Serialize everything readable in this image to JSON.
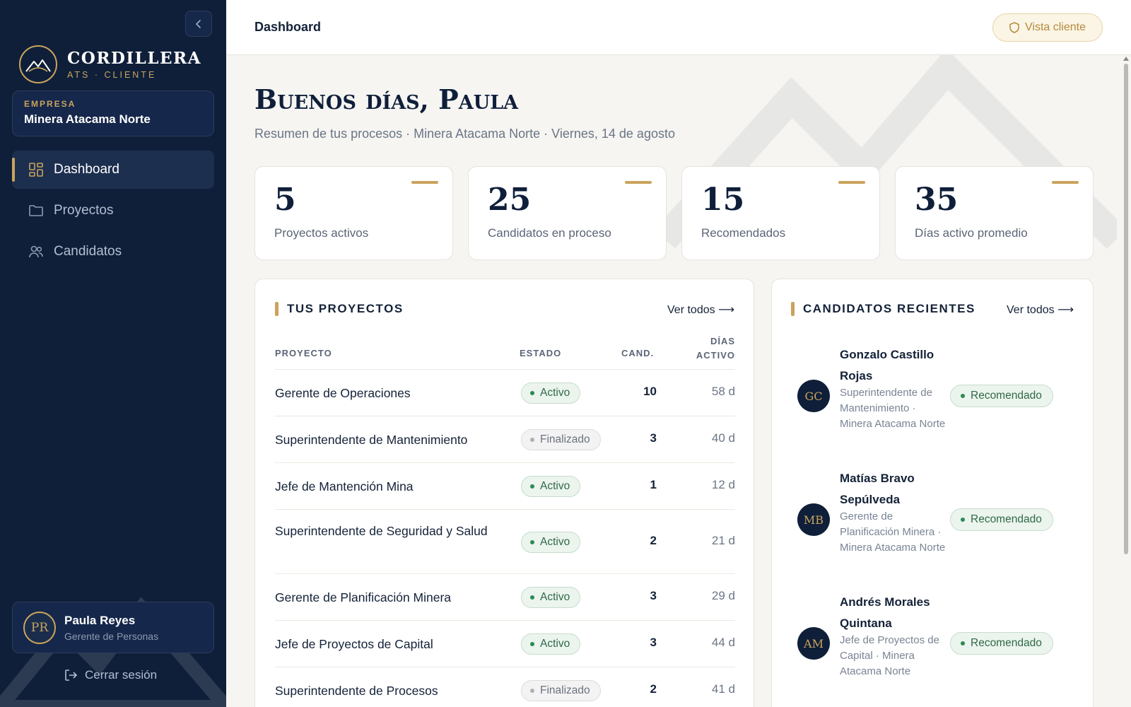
{
  "sidebar": {
    "brand_name": "CORDILLERA",
    "brand_sub": "ATS · CLIENTE",
    "company_label": "EMPRESA",
    "company_name": "Minera Atacama Norte",
    "nav": [
      {
        "label": "Dashboard",
        "icon": "grid-icon",
        "active": true
      },
      {
        "label": "Proyectos",
        "icon": "folder-icon",
        "active": false
      },
      {
        "label": "Candidatos",
        "icon": "users-icon",
        "active": false
      }
    ],
    "user": {
      "initials": "PR",
      "name": "Paula Reyes",
      "role": "Gerente de Personas"
    },
    "logout_label": "Cerrar sesión"
  },
  "header": {
    "title": "Dashboard",
    "client_view_label": "Vista cliente"
  },
  "main": {
    "greeting": "Buenos días, Paula",
    "subtitle": "Resumen de tus procesos · Minera Atacama Norte · Viernes, 14 de agosto",
    "stats": [
      {
        "value": "5",
        "label": "Proyectos activos"
      },
      {
        "value": "25",
        "label": "Candidatos en proceso"
      },
      {
        "value": "15",
        "label": "Recomendados"
      },
      {
        "value": "35",
        "label": "Días activo promedio"
      }
    ],
    "projects": {
      "title": "TUS PROYECTOS",
      "see_all": "Ver todos ⟶",
      "columns": {
        "project": "PROYECTO",
        "status": "ESTADO",
        "cand": "CAND.",
        "days_1": "DÍAS",
        "days_2": "ACTIVO"
      },
      "rows": [
        {
          "name": "Gerente de Operaciones",
          "status": "Activo",
          "cand": "10",
          "days": "58 d"
        },
        {
          "name": "Superintendente de Mantenimiento",
          "status": "Finalizado",
          "cand": "3",
          "days": "40 d"
        },
        {
          "name": "Jefe de Mantención Mina",
          "status": "Activo",
          "cand": "1",
          "days": "12 d"
        },
        {
          "name": "Superintendente de Seguridad y Salud",
          "status": "Activo",
          "cand": "2",
          "days": "21 d"
        },
        {
          "name": "Gerente de Planificación Minera",
          "status": "Activo",
          "cand": "3",
          "days": "29 d"
        },
        {
          "name": "Jefe de Proyectos de Capital",
          "status": "Activo",
          "cand": "3",
          "days": "44 d"
        },
        {
          "name": "Superintendente de Procesos",
          "status": "Finalizado",
          "cand": "2",
          "days": "41 d"
        }
      ]
    },
    "candidates": {
      "title": "CANDIDATOS RECIENTES",
      "see_all": "Ver todos ⟶",
      "items": [
        {
          "initials": "GC",
          "name": "Gonzalo Castillo Rojas",
          "role": "Superintendente de Mantenimiento · Minera Atacama Norte",
          "status": "Recomendado"
        },
        {
          "initials": "MB",
          "name": "Matías Bravo Sepúlveda",
          "role": "Gerente de Planificación Minera · Minera Atacama Norte",
          "status": "Recomendado"
        },
        {
          "initials": "AM",
          "name": "Andrés Morales Quintana",
          "role": "Jefe de Proyectos de Capital · Minera Atacama Norte",
          "status": "Recomendado"
        }
      ]
    }
  },
  "colors": {
    "sidebar_bg": "#0f1f3a",
    "accent_gold": "#c9a45c",
    "active_green": "#2d6a45"
  }
}
